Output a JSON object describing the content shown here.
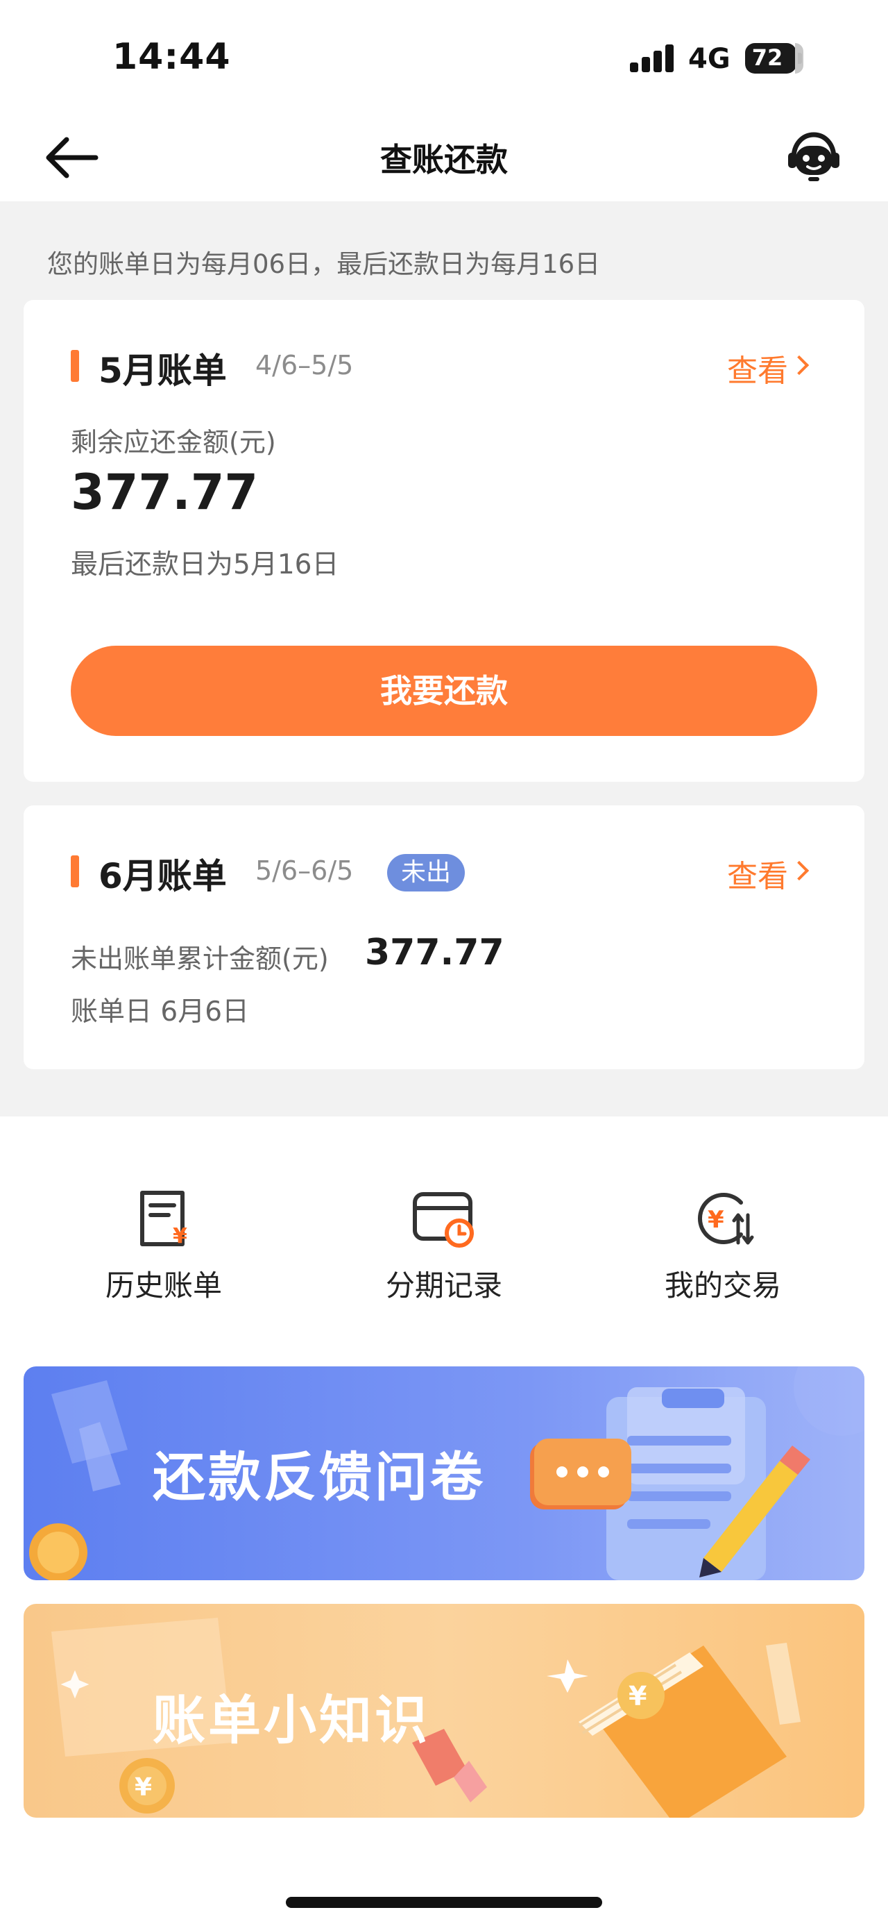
{
  "status_bar": {
    "time": "14:44",
    "network": "4G",
    "battery": "72"
  },
  "nav": {
    "title": "查账还款",
    "back_icon": "back-arrow-icon",
    "service_icon": "customer-service-icon"
  },
  "notice": "您的账单日为每月06日，最后还款日为每月16日",
  "bill_current": {
    "title": "5月账单",
    "period": "4/6–5/5",
    "view_label": "查看",
    "amount_label": "剩余应还金额(元)",
    "amount": "377.77",
    "due_text": "最后还款日为5月16日",
    "repay_button": "我要还款"
  },
  "bill_next": {
    "title": "6月账单",
    "period": "5/6–6/5",
    "badge": "未出",
    "view_label": "查看",
    "amount_label": "未出账单累计金额(元)",
    "amount": "377.77",
    "bill_day": "账单日 6月6日"
  },
  "shortcuts": [
    {
      "label": "历史账单",
      "icon": "bill-history-icon"
    },
    {
      "label": "分期记录",
      "icon": "installment-record-icon"
    },
    {
      "label": "我的交易",
      "icon": "transaction-icon"
    }
  ],
  "banners": [
    {
      "text": "还款反馈问卷",
      "icon": "survey-clipboard-icon"
    },
    {
      "text": "账单小知识",
      "icon": "knowledge-book-icon"
    }
  ],
  "colors": {
    "accent": "#ff7a33",
    "badge": "#6e8ede",
    "background": "#f2f2f2"
  }
}
